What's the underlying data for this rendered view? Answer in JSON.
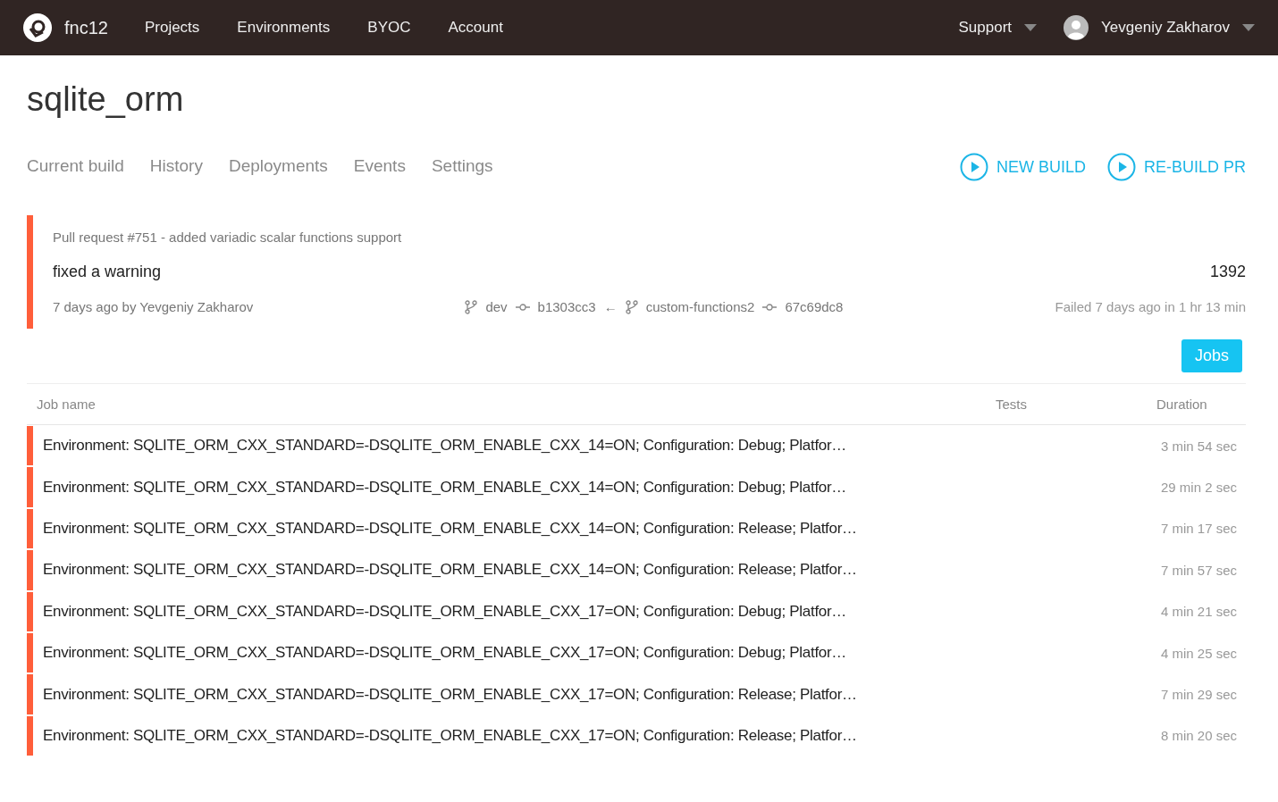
{
  "nav": {
    "brand": "fnc12",
    "links": [
      "Projects",
      "Environments",
      "BYOC",
      "Account"
    ],
    "support": "Support",
    "user": "Yevgeniy Zakharov"
  },
  "project": {
    "title": "sqlite_orm"
  },
  "tabs": [
    {
      "label": "Current build",
      "selected": false
    },
    {
      "label": "History",
      "selected": false
    },
    {
      "label": "Deployments",
      "selected": false
    },
    {
      "label": "Events",
      "selected": false
    },
    {
      "label": "Settings",
      "selected": false
    }
  ],
  "actions": [
    "NEW BUILD",
    "RE-BUILD PR"
  ],
  "build": {
    "color": "#ff5e3a",
    "pull_request": "Pull request #751 - added variadic scalar functions support",
    "message": "fixed a warning",
    "number": "1392",
    "author_line": "7 days ago by Yevgeniy Zakharov",
    "target_branch": "dev",
    "target_commit": "b1303cc3",
    "arrow": "←",
    "source_branch": "custom-functions2",
    "source_commit": "67c69dc8",
    "result": "Failed 7 days ago in 1 hr 13 min"
  },
  "jobs_button": "Jobs",
  "table": {
    "columns": [
      "Job name",
      "Tests",
      "Duration"
    ],
    "rows": [
      {
        "name": "Environment: SQLITE_ORM_CXX_STANDARD=-DSQLITE_ORM_ENABLE_CXX_14=ON; Configuration: Debug; Platfor…",
        "duration": "3 min 54 sec",
        "color": "#ff5e3a"
      },
      {
        "name": "Environment: SQLITE_ORM_CXX_STANDARD=-DSQLITE_ORM_ENABLE_CXX_14=ON; Configuration: Debug; Platfor…",
        "duration": "29 min 2 sec",
        "color": "#ff5e3a"
      },
      {
        "name": "Environment: SQLITE_ORM_CXX_STANDARD=-DSQLITE_ORM_ENABLE_CXX_14=ON; Configuration: Release; Platfor…",
        "duration": "7 min 17 sec",
        "color": "#ff5e3a"
      },
      {
        "name": "Environment: SQLITE_ORM_CXX_STANDARD=-DSQLITE_ORM_ENABLE_CXX_14=ON; Configuration: Release; Platfor…",
        "duration": "7 min 57 sec",
        "color": "#ff5e3a"
      },
      {
        "name": "Environment: SQLITE_ORM_CXX_STANDARD=-DSQLITE_ORM_ENABLE_CXX_17=ON; Configuration: Debug; Platfor…",
        "duration": "4 min 21 sec",
        "color": "#ff5e3a"
      },
      {
        "name": "Environment: SQLITE_ORM_CXX_STANDARD=-DSQLITE_ORM_ENABLE_CXX_17=ON; Configuration: Debug; Platfor…",
        "duration": "4 min 25 sec",
        "color": "#ff5e3a"
      },
      {
        "name": "Environment: SQLITE_ORM_CXX_STANDARD=-DSQLITE_ORM_ENABLE_CXX_17=ON; Configuration: Release; Platfor…",
        "duration": "7 min 29 sec",
        "color": "#ff5e3a"
      },
      {
        "name": "Environment: SQLITE_ORM_CXX_STANDARD=-DSQLITE_ORM_ENABLE_CXX_17=ON; Configuration: Release; Platfor…",
        "duration": "8 min 20 sec",
        "color": "#ff5e3a"
      }
    ]
  }
}
